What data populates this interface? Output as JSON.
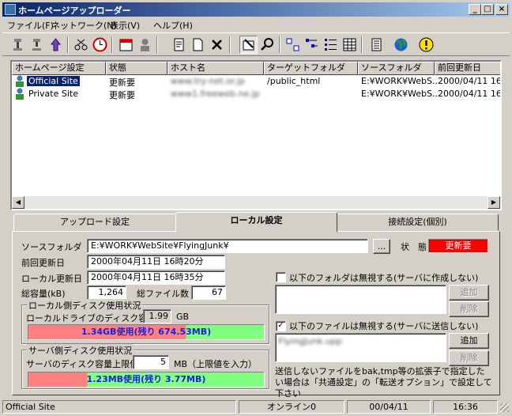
{
  "window": {
    "title": "ホームページアップローダー",
    "min_label": "_",
    "max_label": "□",
    "close_label": "×"
  },
  "menu": [
    "ファイル(F)",
    "ネットワーク(N)",
    "表示(V)",
    "ヘルプ(H)"
  ],
  "toolbar_icons": [
    "connect-icon",
    "disconnect-icon",
    "upload-icon",
    "cut-icon",
    "clock-icon",
    "calendar-icon",
    "user-icon",
    "properties-icon",
    "new-icon",
    "delete-icon",
    "settings-icon",
    "search-icon",
    "large-icons-icon",
    "small-icons-icon",
    "list-icon",
    "details-icon",
    "log-icon",
    "globe-icon",
    "warning-icon"
  ],
  "sites": {
    "columns": [
      "ホームページ設定",
      "状態",
      "ホスト名",
      "ターゲットフォルダ",
      "ソースフォルダ",
      "前回更新日"
    ],
    "rows": [
      {
        "name": "Official Site",
        "status": "更新要",
        "host": "www.try-net.or.jp",
        "target": "/public_html",
        "source": "E:¥WORK¥WebS...",
        "updated": "2000/04/11 16..."
      },
      {
        "name": "Private Site",
        "status": "更新要",
        "host": "www1.freeweb.ne.jp",
        "target": "",
        "source": "E:¥WORK¥WebS...",
        "updated": "2000/04/11 16..."
      }
    ]
  },
  "tabs": [
    "アップロード設定",
    "ローカル設定",
    "接続設定(個別)"
  ],
  "local": {
    "source_folder_label": "ソースフォルダ",
    "source_folder_value": "E:¥WORK¥WebSite¥FlyingJunk¥",
    "browse_label": "...",
    "status_label": "状　態",
    "status_value": "更新要",
    "last_update_label": "前回更新日",
    "last_update_value": "2000年04月11日 16時20分",
    "local_update_label": "ローカル更新日",
    "local_update_value": "2000年04月11日 16時35分",
    "total_size_label": "総容量(kB)",
    "total_size_value": "1,264",
    "total_files_label": "総ファイル数",
    "total_files_value": "67",
    "local_disk_group": "ローカル側ディスク使用状況",
    "local_disk_label": "ローカルドライブのディスク容量",
    "local_disk_value": "1.99",
    "local_disk_unit": "GB",
    "local_bar_text": "1.34GB使用(残り 674.53MB)",
    "local_bar_fraction": 0.67,
    "server_disk_group": "サーバ側ディスク使用状況",
    "server_limit_label": "サーバのディスク容量上限値",
    "server_limit_value": "5",
    "server_limit_unit": "MB（上限値を入力）",
    "server_bar_text": "1.23MB使用(残り 3.77MB)",
    "server_bar_fraction": 0.25,
    "ignore_folders_label": "以下のフォルダは無視する(サーバに作成しない)",
    "ignore_folders_checked": false,
    "ignore_files_label": "以下のファイルは無視する(サーバに送信しない)",
    "ignore_files_checked": true,
    "ignore_files_value": "FlyingJunk.upp",
    "add_label": "追加",
    "remove_label": "削除",
    "note": "送信しないファイルをbak,tmp等の拡張子で指定したい場合は「共通設定」の「転送オプション」で設定して下さい"
  },
  "status": {
    "site": "Official Site",
    "connection": "オンライン0",
    "date": "00/04/11",
    "time": "16:36"
  },
  "colors": {
    "status_red": "#ff0000",
    "bar_green": "#80ff80",
    "bar_red": "#ff8080",
    "bar_text": "#1a20e0"
  }
}
